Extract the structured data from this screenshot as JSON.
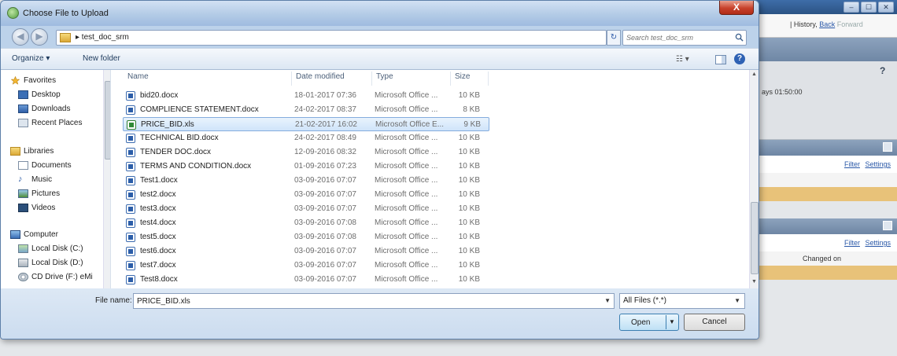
{
  "background": {
    "history_label": "| History",
    "back_label": "Back",
    "forward_label": "Forward",
    "help_glyph": "?",
    "days_text": "ays 01:50:00",
    "filter_label": "Filter",
    "settings_label": "Settings",
    "changed_on_label": "Changed on",
    "window_buttons": [
      "–",
      "☐",
      "✕"
    ]
  },
  "dialog": {
    "title": "Choose File to Upload",
    "close_label": "X",
    "address": {
      "path": "▸ test_doc_srm",
      "search_placeholder": "Search test_doc_srm"
    },
    "toolbar": {
      "organize_label": "Organize ▾",
      "new_folder_label": "New folder",
      "views_label": "☷ ▾",
      "help_label": "?"
    },
    "nav": {
      "favorites_label": "Favorites",
      "favorites": [
        "Desktop",
        "Downloads",
        "Recent Places"
      ],
      "libraries_label": "Libraries",
      "libraries": [
        "Documents",
        "Music",
        "Pictures",
        "Videos"
      ],
      "computer_label": "Computer",
      "drives": [
        "Local Disk (C:)",
        "Local Disk (D:)",
        "CD Drive (F:) eMi"
      ]
    },
    "columns": {
      "name": "Name",
      "date_modified": "Date modified",
      "type": "Type",
      "size": "Size"
    },
    "files": [
      {
        "name": "bid20.docx",
        "date": "18-01-2017 07:36",
        "type": "Microsoft Office ...",
        "size": "10 KB",
        "kind": "doc"
      },
      {
        "name": "COMPLIENCE STATEMENT.docx",
        "date": "24-02-2017 08:37",
        "type": "Microsoft Office ...",
        "size": "8 KB",
        "kind": "doc"
      },
      {
        "name": "PRICE_BID.xls",
        "date": "21-02-2017 16:02",
        "type": "Microsoft Office E...",
        "size": "9 KB",
        "kind": "xls"
      },
      {
        "name": "TECHNICAL BID.docx",
        "date": "24-02-2017 08:49",
        "type": "Microsoft Office ...",
        "size": "10 KB",
        "kind": "doc"
      },
      {
        "name": "TENDER DOC.docx",
        "date": "12-09-2016 08:32",
        "type": "Microsoft Office ...",
        "size": "10 KB",
        "kind": "doc"
      },
      {
        "name": "TERMS AND CONDITION.docx",
        "date": "01-09-2016 07:23",
        "type": "Microsoft Office ...",
        "size": "10 KB",
        "kind": "doc"
      },
      {
        "name": "Test1.docx",
        "date": "03-09-2016 07:07",
        "type": "Microsoft Office ...",
        "size": "10 KB",
        "kind": "doc"
      },
      {
        "name": "test2.docx",
        "date": "03-09-2016 07:07",
        "type": "Microsoft Office ...",
        "size": "10 KB",
        "kind": "doc"
      },
      {
        "name": "test3.docx",
        "date": "03-09-2016 07:07",
        "type": "Microsoft Office ...",
        "size": "10 KB",
        "kind": "doc"
      },
      {
        "name": "test4.docx",
        "date": "03-09-2016 07:08",
        "type": "Microsoft Office ...",
        "size": "10 KB",
        "kind": "doc"
      },
      {
        "name": "test5.docx",
        "date": "03-09-2016 07:08",
        "type": "Microsoft Office ...",
        "size": "10 KB",
        "kind": "doc"
      },
      {
        "name": "test6.docx",
        "date": "03-09-2016 07:07",
        "type": "Microsoft Office ...",
        "size": "10 KB",
        "kind": "doc"
      },
      {
        "name": "test7.docx",
        "date": "03-09-2016 07:07",
        "type": "Microsoft Office ...",
        "size": "10 KB",
        "kind": "doc"
      },
      {
        "name": "Test8.docx",
        "date": "03-09-2016 07:07",
        "type": "Microsoft Office ...",
        "size": "10 KB",
        "kind": "doc"
      }
    ],
    "selected_file": "PRICE_BID.xls",
    "file_name_label": "File name:",
    "file_name_value": "PRICE_BID.xls",
    "filter_value": "All Files (*.*)",
    "open_label": "Open",
    "cancel_label": "Cancel"
  },
  "colors": {
    "selection": "#cfe4fa",
    "title_bar": "#b3cbe6",
    "close_button": "#c7412b",
    "background_orange": "#e8c279"
  }
}
